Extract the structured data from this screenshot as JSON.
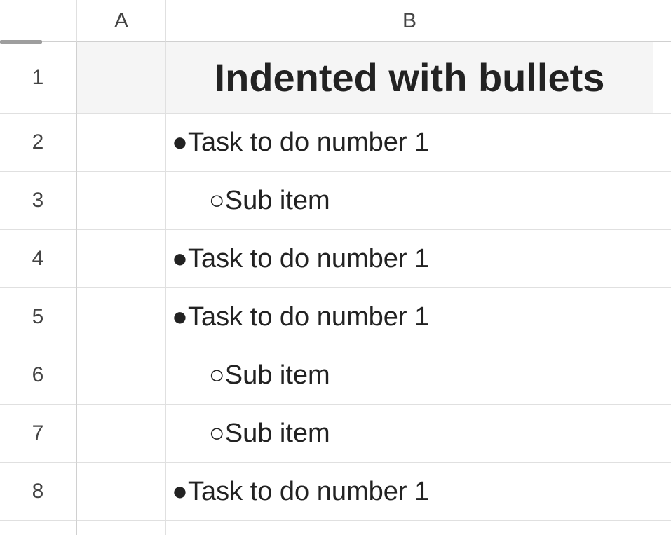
{
  "columns": {
    "A": "A",
    "B": "B"
  },
  "rows": {
    "1": "1",
    "2": "2",
    "3": "3",
    "4": "4",
    "5": "5",
    "6": "6",
    "7": "7",
    "8": "8"
  },
  "cells": {
    "title": "Indented with bullets",
    "r2": "●Task to do number 1",
    "r3": "     ○Sub item",
    "r4": "●Task to do number 1",
    "r5": "●Task to do number 1",
    "r6": "     ○Sub item",
    "r7": "     ○Sub item",
    "r8": "●Task to do number 1"
  }
}
